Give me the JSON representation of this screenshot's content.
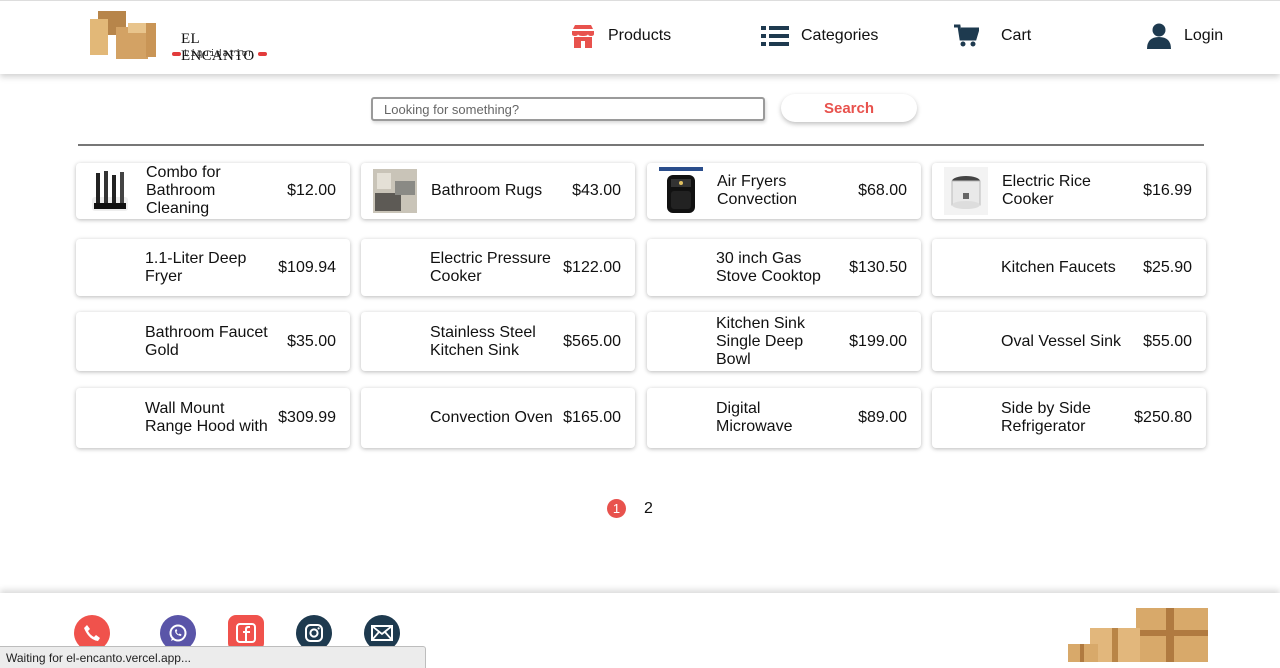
{
  "brand": {
    "title": "EL ENCANTO",
    "subtitle": "Liquidation"
  },
  "nav": [
    {
      "label": "Products",
      "icon": "store-icon",
      "color": "#e8524d"
    },
    {
      "label": "Categories",
      "icon": "list-icon",
      "color": "#1e3a4f"
    },
    {
      "label": "Cart",
      "icon": "cart-icon",
      "color": "#1e3a4f"
    },
    {
      "label": "Login",
      "icon": "user-icon",
      "color": "#1e3a4f"
    }
  ],
  "search": {
    "placeholder": "Looking for something?",
    "value": "",
    "button_label": "Search"
  },
  "products": [
    {
      "name": "Combo for Bathroom Cleaning",
      "price": "$12.00",
      "has_image": true,
      "image": "brush-set"
    },
    {
      "name": "Bathroom Rugs",
      "price": "$43.00",
      "has_image": true,
      "image": "rugs"
    },
    {
      "name": "Air Fryers Convection",
      "price": "$68.00",
      "has_image": true,
      "image": "air-fryer"
    },
    {
      "name": "Electric Rice Cooker",
      "price": "$16.99",
      "has_image": true,
      "image": "rice-cooker"
    },
    {
      "name": "1.1-Liter Deep Fryer",
      "price": "$109.94",
      "has_image": false
    },
    {
      "name": "Electric Pressure Cooker",
      "price": "$122.00",
      "has_image": false
    },
    {
      "name": "30 inch Gas Stove Cooktop",
      "price": "$130.50",
      "has_image": false
    },
    {
      "name": "Kitchen Faucets",
      "price": "$25.90",
      "has_image": false
    },
    {
      "name": "Bathroom Faucet Gold",
      "price": "$35.00",
      "has_image": false
    },
    {
      "name": "Stainless Steel Kitchen Sink",
      "price": "$565.00",
      "has_image": false
    },
    {
      "name": "Kitchen Sink Single Deep Bowl",
      "price": "$199.00",
      "has_image": false
    },
    {
      "name": "Oval Vessel Sink",
      "price": "$55.00",
      "has_image": false
    },
    {
      "name": "Wall Mount Range Hood with",
      "price": "$309.99",
      "has_image": false
    },
    {
      "name": "Convection Oven",
      "price": "$165.00",
      "has_image": false
    },
    {
      "name": "Digital Microwave",
      "price": "$89.00",
      "has_image": false
    },
    {
      "name": "Side by Side Refrigerator",
      "price": "$250.80",
      "has_image": false
    }
  ],
  "pagination": {
    "current": "1",
    "pages": [
      "1",
      "2"
    ]
  },
  "footer": {
    "social": [
      {
        "icon": "phone-icon",
        "color": "#f0524c"
      },
      {
        "icon": "whatsapp-icon",
        "color": "#5a55a8"
      },
      {
        "icon": "facebook-icon",
        "color": "#f0524c"
      },
      {
        "icon": "instagram-icon",
        "color": "#1e3a4f"
      },
      {
        "icon": "mail-icon",
        "color": "#1e3a4f"
      }
    ]
  },
  "status_bar": {
    "text": "Waiting for el-encanto.vercel.app..."
  },
  "colors": {
    "accent": "#e8524d",
    "navy": "#1e3a4f",
    "box": "#d8a96a"
  }
}
